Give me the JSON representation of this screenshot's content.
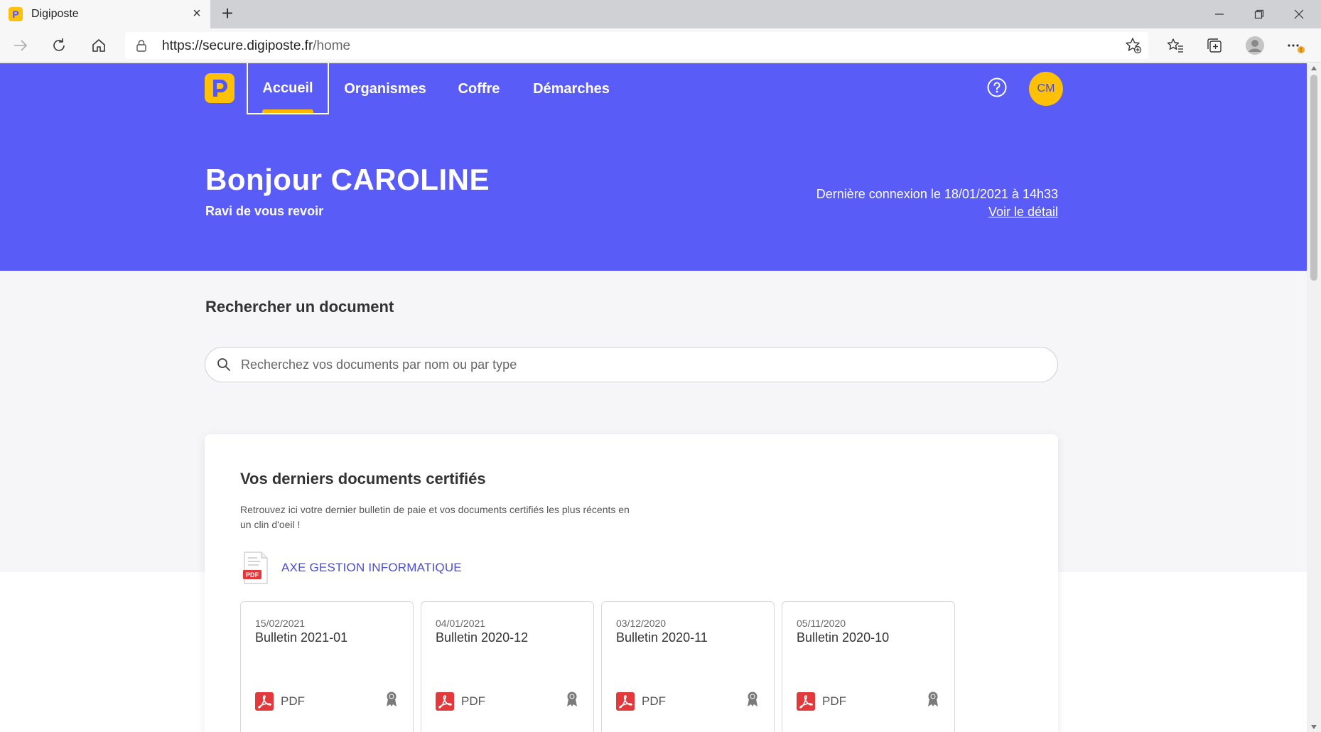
{
  "browser": {
    "tab_title": "Digiposte",
    "tab_favicon": "P",
    "url_host": "https://secure.digiposte.fr",
    "url_path": "/home"
  },
  "header": {
    "nav": [
      "Accueil",
      "Organismes",
      "Coffre",
      "Démarches"
    ],
    "avatar_initials": "CM"
  },
  "hero": {
    "greeting": "Bonjour CAROLINE",
    "subtitle": "Ravi de vous revoir",
    "last_connection": "Dernière connexion le 18/01/2021 à 14h33",
    "detail_link": "Voir le détail"
  },
  "search": {
    "title": "Rechercher un document",
    "placeholder": "Recherchez vos documents par nom ou par type"
  },
  "certified": {
    "title": "Vos derniers documents certifiés",
    "description": "Retrouvez ici votre dernier bulletin de paie et vos documents certifiés les plus récents en un clin d'oeil !",
    "organization": "AXE GESTION INFORMATIQUE",
    "org_icon_text": "PDF",
    "documents": [
      {
        "date": "15/02/2021",
        "name": "Bulletin 2021-01",
        "type": "PDF"
      },
      {
        "date": "04/01/2021",
        "name": "Bulletin 2020-12",
        "type": "PDF"
      },
      {
        "date": "03/12/2020",
        "name": "Bulletin 2020-11",
        "type": "PDF"
      },
      {
        "date": "05/11/2020",
        "name": "Bulletin 2020-10",
        "type": "PDF"
      }
    ]
  },
  "colors": {
    "brand_purple": "#5a5cf8",
    "brand_yellow": "#ffc107",
    "pdf_red": "#e2393c"
  }
}
